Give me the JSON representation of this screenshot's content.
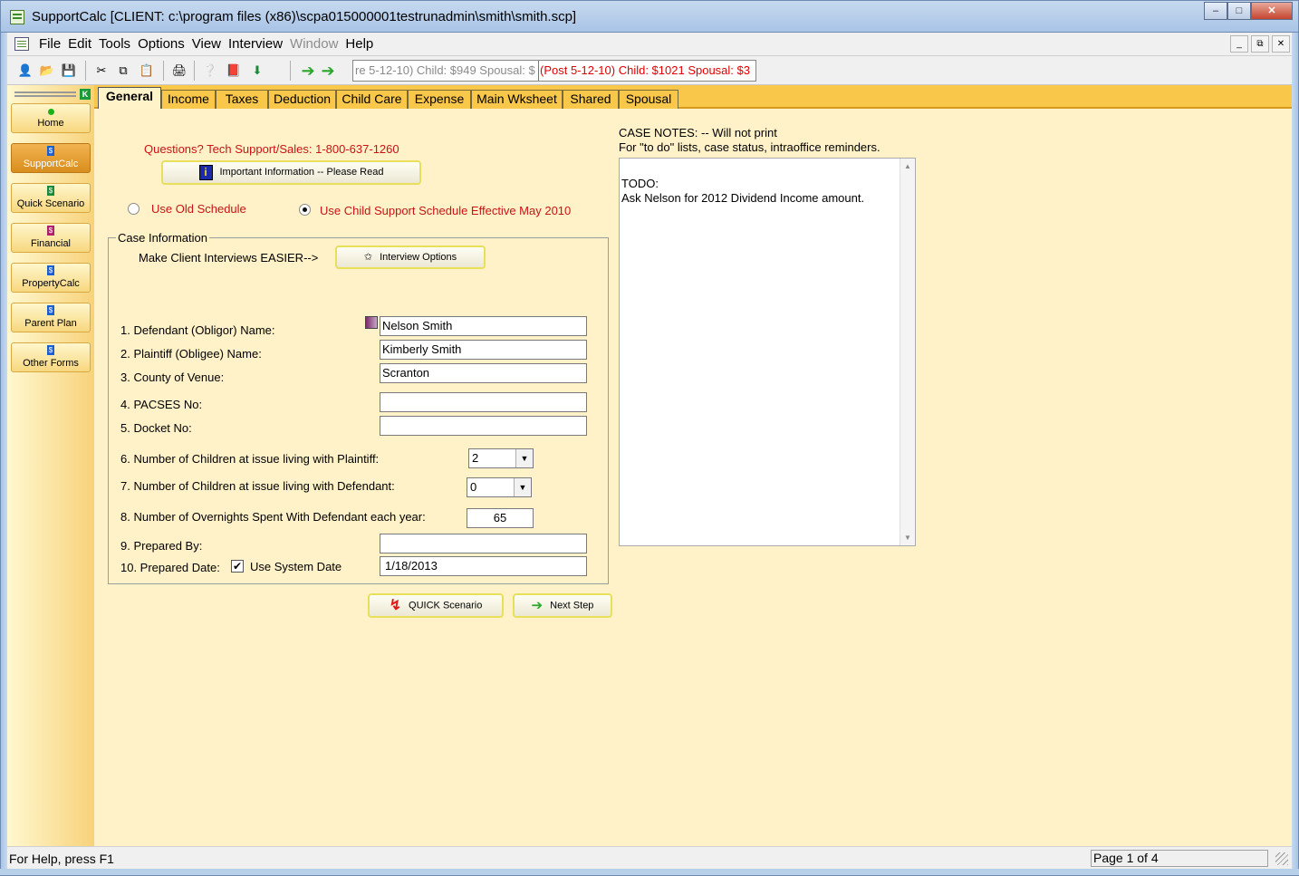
{
  "window": {
    "title": "SupportCalc  [CLIENT: c:\\program files (x86)\\scpa015000001testrunadmin\\smith\\smith.scp]",
    "minimize": "–",
    "maximize": "□",
    "close": "✕"
  },
  "menu": {
    "items": [
      "File",
      "Edit",
      "Tools",
      "Options",
      "View",
      "Interview",
      "Window",
      "Help"
    ],
    "mdi_minimize": "_",
    "mdi_restore": "⧉",
    "mdi_close": "✕"
  },
  "toolbar": {
    "icons": [
      "new-client-icon",
      "open-folder-icon",
      "save-icon",
      "cut-icon",
      "copy-icon",
      "paste-icon",
      "print-icon",
      "help-icon",
      "book-icon",
      "download-icon",
      "back-arrow-icon",
      "forward-arrow-icon"
    ],
    "pre_status": "re 5-12-10) Child: $949  Spousal: $",
    "post_status": "(Post 5-12-10) Child: $1021  Spousal: $3"
  },
  "sidebar": {
    "items": [
      {
        "label": "Home",
        "icon": "home-icon"
      },
      {
        "label": "SupportCalc",
        "icon": "supportcalc-icon"
      },
      {
        "label": "Quick Scenario",
        "icon": "quick-scenario-icon"
      },
      {
        "label": "Financial",
        "icon": "financial-icon"
      },
      {
        "label": "PropertyCalc",
        "icon": "propertycalc-icon"
      },
      {
        "label": "Parent Plan",
        "icon": "parent-plan-icon"
      },
      {
        "label": "Other Forms",
        "icon": "other-forms-icon"
      }
    ],
    "active": "SupportCalc"
  },
  "tabs": [
    "General",
    "Income",
    "Taxes",
    "Deduction",
    "Child Care",
    "Expense",
    "Main Wksheet",
    "Shared",
    "Spousal"
  ],
  "active_tab": "General",
  "general": {
    "questions": "Questions?  Tech Support/Sales: 1-800-637-1260",
    "important_button": "Important Information -- Please Read",
    "schedule_old": "Use Old Schedule",
    "schedule_new": "Use Child Support Schedule Effective May 2010",
    "schedule_selected": "new",
    "case_info_legend": "Case Information",
    "interview_prompt": "Make Client Interviews EASIER-->",
    "interview_button": "Interview Options",
    "fields": {
      "defendant_label": "1. Defendant (Obligor) Name:",
      "defendant_value": "Nelson Smith",
      "plaintiff_label": "2. Plaintiff (Obligee) Name:",
      "plaintiff_value": "Kimberly Smith",
      "county_label": "3. County of Venue:",
      "county_value": "Scranton",
      "pacses_label": "4. PACSES No:",
      "pacses_value": "",
      "docket_label": "5. Docket No:",
      "docket_value": "",
      "children_plaintiff_label": "6. Number of Children at issue living with Plaintiff:",
      "children_plaintiff_value": "2",
      "children_defendant_label": "7. Number of Children at issue living with Defendant:",
      "children_defendant_value": "0",
      "overnights_label": "8. Number of Overnights Spent With Defendant each year:",
      "overnights_value": "65",
      "prepared_by_label": "9. Prepared By:",
      "prepared_by_value": "",
      "prepared_date_label": "10. Prepared Date:",
      "use_system_date_label": "Use System Date",
      "use_system_date_checked": "✔",
      "prepared_date_value": "1/18/2013"
    },
    "quick_button": "QUICK Scenario",
    "next_button": "Next Step",
    "notes_title": "CASE NOTES: -- Will not print",
    "notes_subtitle": "For \"to do\" lists, case status, intraoffice reminders.",
    "notes_line1": "TODO:",
    "notes_line2": "Ask Nelson for 2012 Dividend Income amount."
  },
  "statusbar": {
    "help": "For Help, press F1",
    "page": "Page 1 of 4"
  },
  "colors": {
    "panel_bg": "#fff1c8",
    "tab_strip": "#f9c74a",
    "accent_red": "#c81414",
    "sidebar_active": "#d98e1d"
  }
}
